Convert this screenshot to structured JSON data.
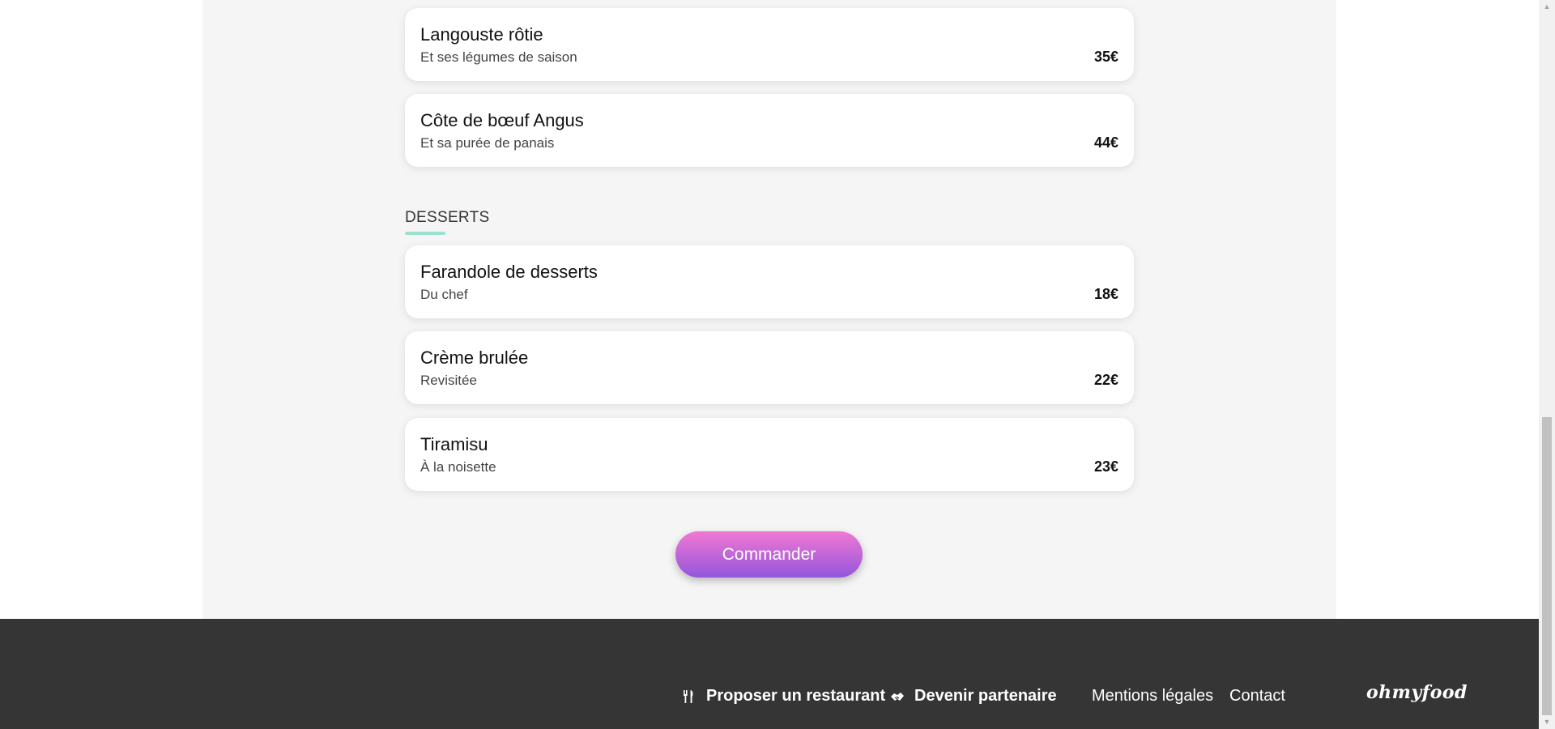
{
  "main_courses": [
    {
      "name": "Langouste rôtie",
      "description": "Et ses légumes de saison",
      "price": "35€"
    },
    {
      "name": "Côte de bœuf Angus",
      "description": "Et sa purée de panais",
      "price": "44€"
    }
  ],
  "desserts": {
    "title": "DESSERTS",
    "items": [
      {
        "name": "Farandole de desserts",
        "description": "Du chef",
        "price": "18€"
      },
      {
        "name": "Crème brulée",
        "description": "Revisitée",
        "price": "22€"
      },
      {
        "name": "Tiramisu",
        "description": "À la noisette",
        "price": "23€"
      }
    ]
  },
  "order_button": {
    "label": "Commander"
  },
  "footer": {
    "propose_label": "Proposer un restaurant",
    "propose_icon": "utensils-icon",
    "partner_label": "Devenir partenaire",
    "partner_icon": "handshake-icon",
    "legal_label": "Mentions légales",
    "contact_label": "Contact",
    "logo_text": "ohmyfood"
  },
  "colors": {
    "accent_underline": "#99e2d0",
    "button_gradient_top": "#f178d4",
    "button_gradient_bottom": "#9356dc",
    "footer_background": "#353535",
    "panel_background": "#f5f5f5"
  }
}
